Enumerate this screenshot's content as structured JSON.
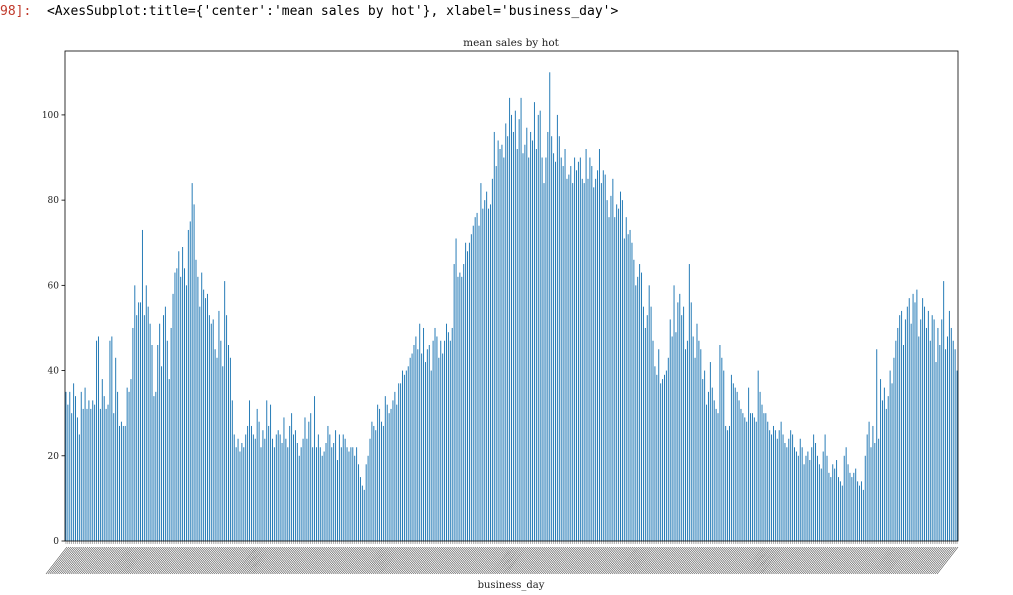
{
  "cell": {
    "prompt": "98]:",
    "repr": "<AxesSubplot:title={'center':'mean sales by hot'}, xlabel='business_day'>"
  },
  "colors": {
    "bar": "#1f77b4",
    "axes": "#000000",
    "prompt": "#c0392b"
  },
  "chart_data": {
    "type": "bar",
    "title": "mean sales by hot",
    "xlabel": "business_day",
    "ylabel": "",
    "ylim": [
      0,
      115
    ],
    "yticks": [
      0,
      20,
      40,
      60,
      80,
      100
    ],
    "grid": false,
    "legend": "none",
    "xtick_labels": "unreadable (rotated and overlapping)",
    "values": [
      35,
      32,
      35,
      30,
      37,
      34,
      29,
      25,
      35,
      31,
      36,
      31,
      33,
      31,
      33,
      32,
      47,
      48,
      31,
      38,
      34,
      31,
      32,
      47,
      48,
      30,
      43,
      35,
      27,
      28,
      27,
      27,
      36,
      35,
      38,
      50,
      60,
      53,
      56,
      56,
      73,
      53,
      60,
      55,
      51,
      46,
      34,
      35,
      46,
      51,
      41,
      53,
      55,
      47,
      38,
      50,
      58,
      63,
      64,
      68,
      62,
      69,
      64,
      60,
      73,
      75,
      84,
      79,
      66,
      62,
      55,
      63,
      59,
      57,
      58,
      53,
      51,
      52,
      45,
      43,
      54,
      47,
      41,
      61,
      53,
      46,
      43,
      33,
      25,
      22,
      24,
      21,
      23,
      22,
      25,
      27,
      33,
      27,
      25,
      24,
      31,
      28,
      22,
      26,
      24,
      33,
      27,
      32,
      24,
      22,
      25,
      26,
      25,
      23,
      29,
      24,
      22,
      27,
      30,
      25,
      26,
      23,
      20,
      22,
      24,
      29,
      24,
      28,
      30,
      22,
      34,
      22,
      25,
      22,
      20,
      21,
      23,
      27,
      25,
      22,
      23,
      26,
      19,
      25,
      22,
      25,
      24,
      22,
      21,
      22,
      22,
      20,
      22,
      18,
      15,
      13,
      12,
      18,
      20,
      24,
      28,
      27,
      26,
      32,
      31,
      28,
      27,
      34,
      32,
      30,
      31,
      33,
      35,
      32,
      37,
      37,
      40,
      39,
      40,
      41,
      43,
      44,
      46,
      48,
      45,
      51,
      44,
      50,
      42,
      45,
      46,
      40,
      47,
      50,
      48,
      43,
      47,
      44,
      47,
      51,
      49,
      47,
      50,
      65,
      71,
      62,
      63,
      62,
      65,
      70,
      68,
      70,
      72,
      74,
      76,
      77,
      74,
      84,
      78,
      80,
      82,
      78,
      79,
      85,
      96,
      88,
      94,
      92,
      93,
      90,
      98,
      95,
      104,
      100,
      96,
      101,
      92,
      99,
      104,
      91,
      93,
      97,
      90,
      96,
      94,
      103,
      92,
      100,
      101,
      90,
      84,
      90,
      96,
      110,
      95,
      91,
      89,
      100,
      95,
      90,
      88,
      92,
      85,
      86,
      88,
      84,
      90,
      87,
      89,
      90,
      85,
      84,
      92,
      85,
      90,
      88,
      83,
      85,
      87,
      92,
      84,
      87,
      86,
      80,
      76,
      81,
      85,
      76,
      79,
      78,
      82,
      80,
      71,
      76,
      72,
      73,
      70,
      66,
      60,
      62,
      65,
      63,
      55,
      50,
      53,
      60,
      55,
      47,
      41,
      39,
      45,
      37,
      38,
      39,
      40,
      43,
      52,
      48,
      60,
      49,
      56,
      58,
      53,
      55,
      45,
      47,
      65,
      56,
      48,
      43,
      51,
      47,
      45,
      38,
      40,
      32,
      35,
      42,
      36,
      33,
      31,
      30,
      46,
      43,
      40,
      27,
      26,
      27,
      39,
      37,
      36,
      35,
      33,
      31,
      30,
      29,
      28,
      36,
      30,
      30,
      29,
      28,
      40,
      35,
      32,
      30,
      30,
      28,
      26,
      25,
      27,
      26,
      24,
      26,
      28,
      25,
      23,
      22,
      24,
      26,
      25,
      22,
      21,
      20,
      24,
      22,
      18,
      20,
      21,
      19,
      22,
      25,
      23,
      20,
      18,
      17,
      21,
      25,
      20,
      16,
      15,
      18,
      17,
      19,
      15,
      14,
      13,
      20,
      22,
      18,
      16,
      15,
      16,
      17,
      14,
      13,
      14,
      12,
      20,
      25,
      28,
      22,
      27,
      23,
      45,
      24,
      38,
      33,
      36,
      31,
      34,
      40,
      37,
      43,
      47,
      50,
      53,
      54,
      46,
      52,
      55,
      57,
      51,
      58,
      56,
      59,
      48,
      52,
      57,
      55,
      50,
      54,
      47,
      53,
      52,
      42,
      50,
      46,
      52,
      61,
      45,
      48,
      54,
      50,
      47,
      45,
      40
    ]
  }
}
